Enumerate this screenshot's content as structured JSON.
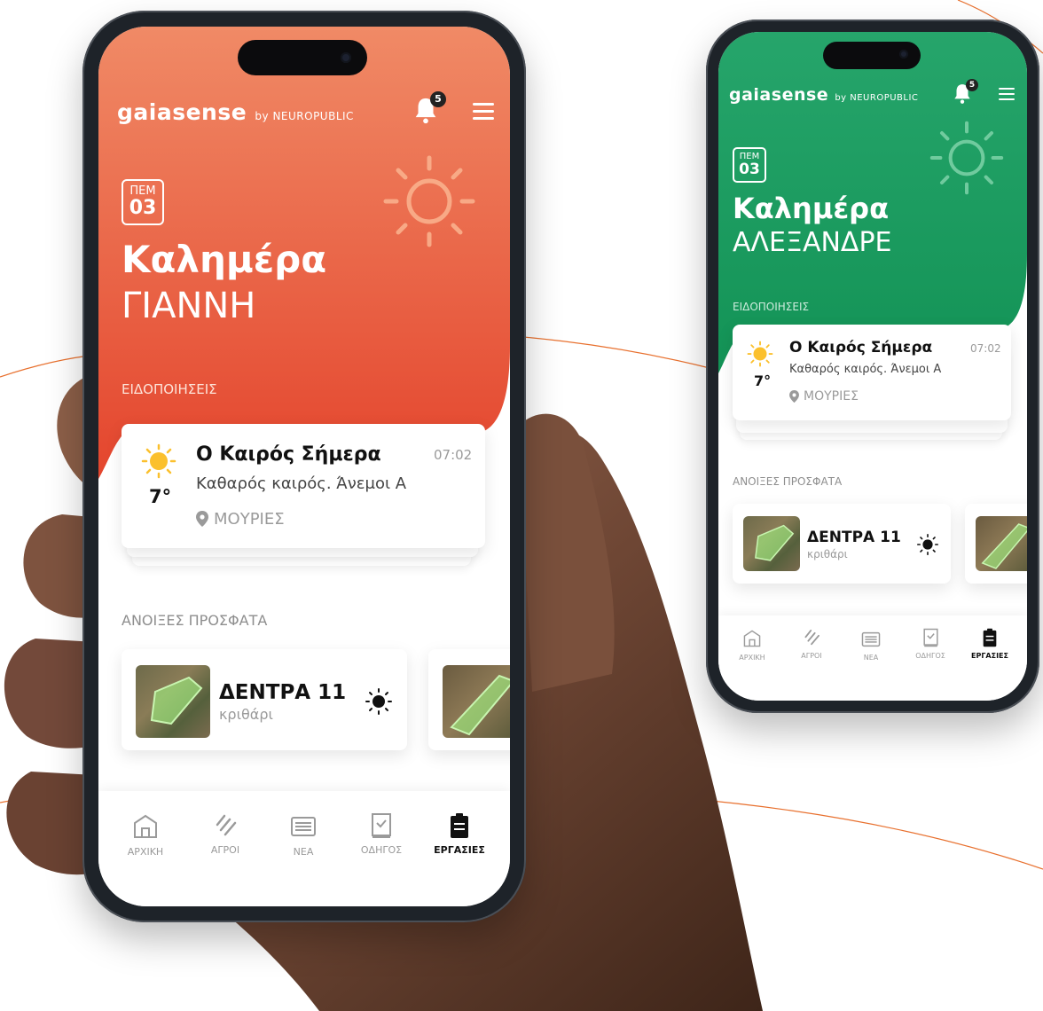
{
  "colors": {
    "orange_top": "#f08a66",
    "orange_bottom": "#e4452d",
    "green_top": "#26a56b",
    "green_bottom": "#139356",
    "accent_line": "#e8702e",
    "nav_inactive": "#9a9a9a",
    "nav_active": "#111111"
  },
  "phones": [
    {
      "theme": "orange",
      "brand": "gaiasense",
      "brand_by": "by NEUROPUBLIC",
      "notification_count": "5",
      "day": "ΠΕΜ",
      "date": "03",
      "greeting": "Καλημέρα",
      "name": "ΓΙΑΝΝΗ",
      "notifications_label": "ΕΙΔΟΠΟΙΗΣΕΙΣ",
      "weather_card": {
        "title": "Ο Καιρός Σήμερα",
        "time": "07:02",
        "description": "Καθαρός καιρός. Άνεμοι Α",
        "temp": "7°",
        "location": "ΜΟΥΡΙΕΣ"
      },
      "recent_label": "ΑΝΟΙΞΕΣ ΠΡΟΣΦΑΤΑ",
      "field_card": {
        "name": "ΔΕΝΤΡΑ 11",
        "crop": "κριθάρι"
      },
      "nav": [
        {
          "label": "ΑΡΧΙΚΗ",
          "icon": "home-icon",
          "active": false
        },
        {
          "label": "ΑΓΡΟΙ",
          "icon": "fields-icon",
          "active": false
        },
        {
          "label": "ΝΕΑ",
          "icon": "news-icon",
          "active": false
        },
        {
          "label": "ΟΔΗΓΟΣ",
          "icon": "guide-icon",
          "active": false
        },
        {
          "label": "ΕΡΓΑΣΙΕΣ",
          "icon": "tasks-icon",
          "active": true
        }
      ]
    },
    {
      "theme": "green",
      "brand": "gaiasense",
      "brand_by": "by NEUROPUBLIC",
      "notification_count": "5",
      "day": "ΠΕΜ",
      "date": "03",
      "greeting": "Καλημέρα",
      "name": "ΑΛΕΞΑΝΔΡΕ",
      "notifications_label": "ΕΙΔΟΠΟΙΗΣΕΙΣ",
      "weather_card": {
        "title": "Ο Καιρός Σήμερα",
        "time": "07:02",
        "description": "Καθαρός καιρός. Άνεμοι Α",
        "temp": "7°",
        "location": "ΜΟΥΡΙΕΣ"
      },
      "recent_label": "ΑΝΟΙΞΕΣ ΠΡΟΣΦΑΤΑ",
      "field_card": {
        "name": "ΔΕΝΤΡΑ 11",
        "crop": "κριθάρι"
      },
      "nav": [
        {
          "label": "ΑΡΧΙΚΗ",
          "icon": "home-icon",
          "active": false
        },
        {
          "label": "ΑΓΡΟΙ",
          "icon": "fields-icon",
          "active": false
        },
        {
          "label": "ΝΕΑ",
          "icon": "news-icon",
          "active": false
        },
        {
          "label": "ΟΔΗΓΟΣ",
          "icon": "guide-icon",
          "active": false
        },
        {
          "label": "ΕΡΓΑΣΙΕΣ",
          "icon": "tasks-icon",
          "active": true
        }
      ]
    }
  ]
}
